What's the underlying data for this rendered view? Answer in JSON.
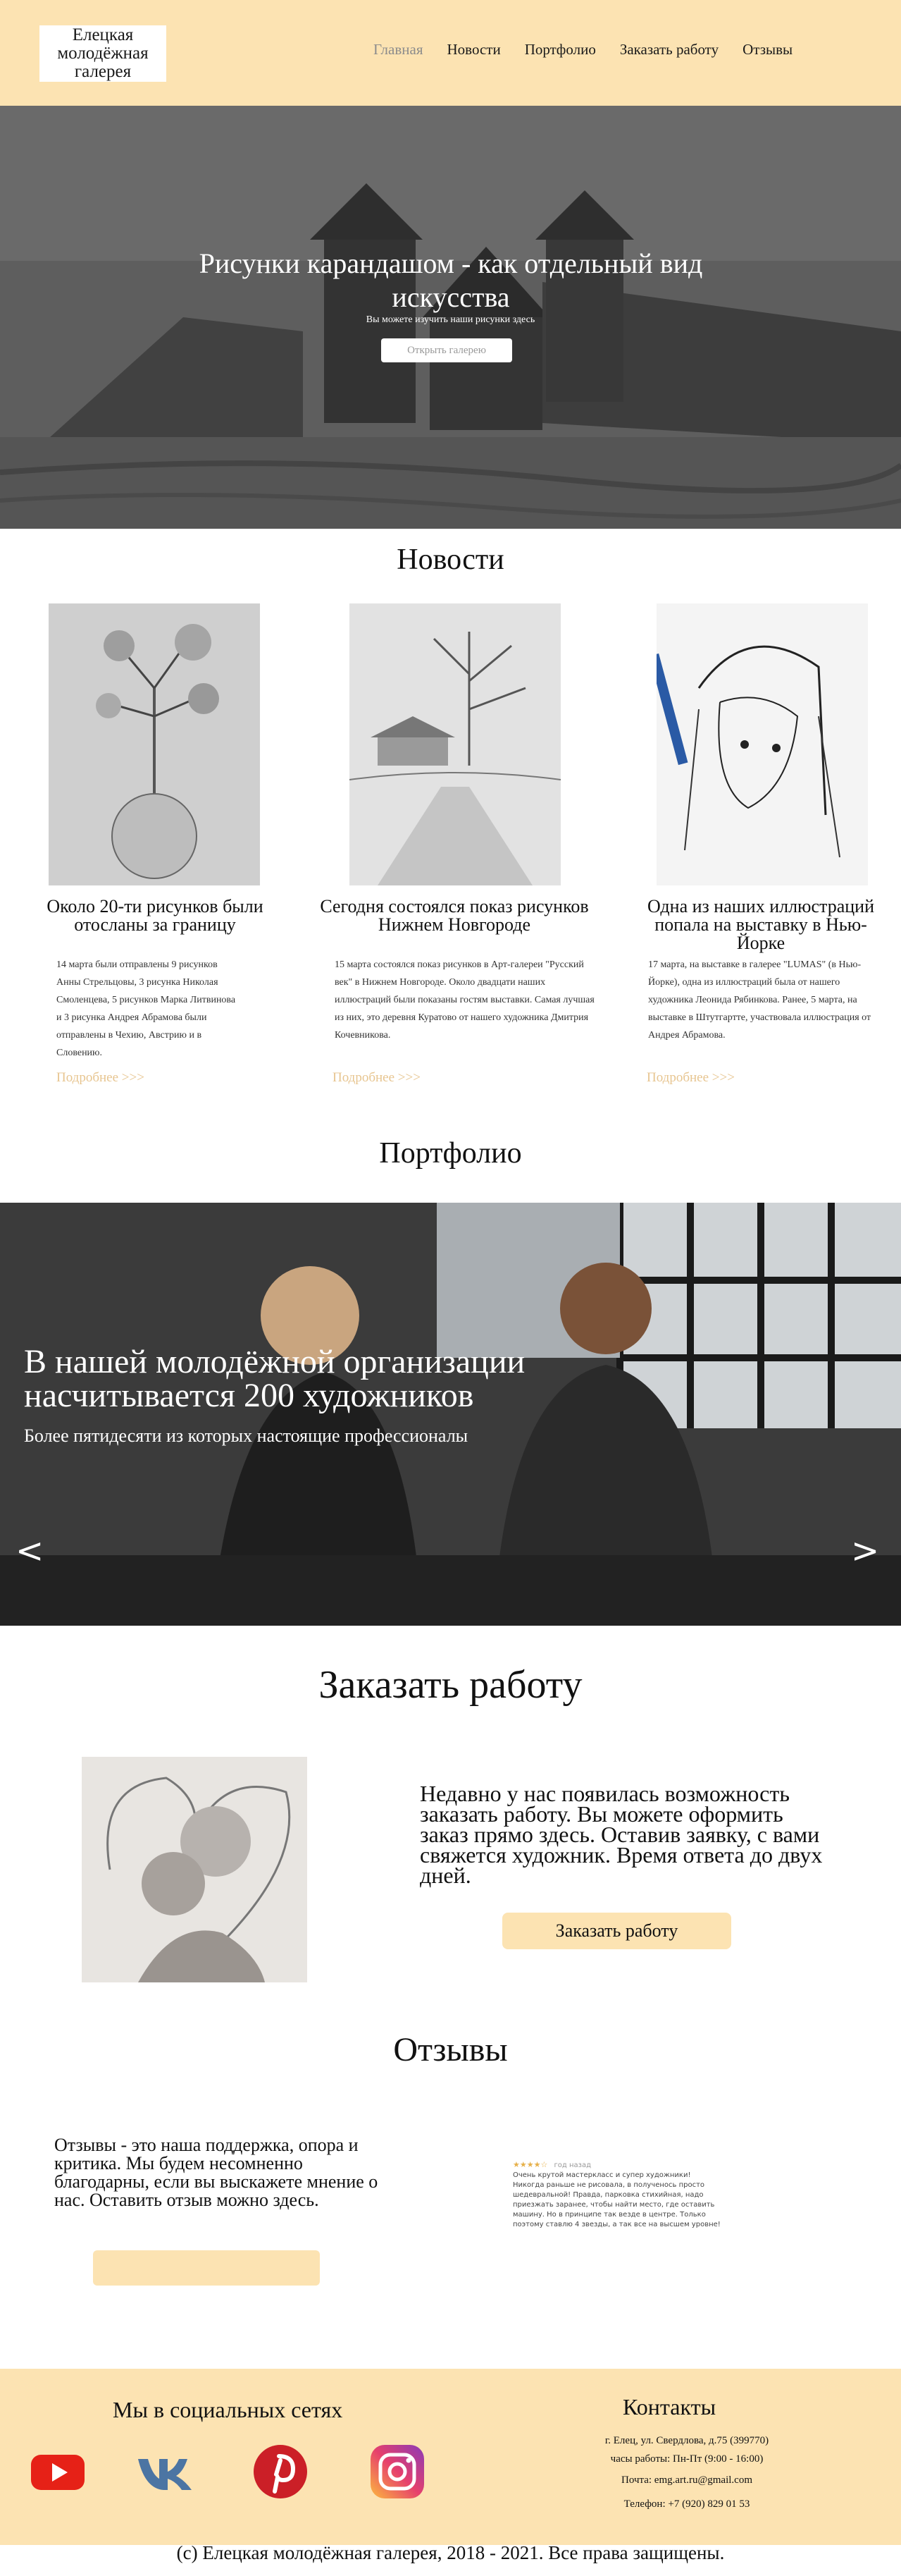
{
  "header": {
    "logo": "Елецкая молодёжная галерея",
    "nav": [
      {
        "label": "Главная",
        "active": true
      },
      {
        "label": "Новости",
        "active": false
      },
      {
        "label": "Портфолио",
        "active": false
      },
      {
        "label": "Заказать работу",
        "active": false
      },
      {
        "label": "Отзывы",
        "active": false
      }
    ]
  },
  "hero": {
    "title": "Рисунки карандашом - как отдельный вид искусства",
    "subtitle": "Вы можете изучить наши рисунки здесь",
    "button": "Открыть галерею"
  },
  "news": {
    "heading": "Новости",
    "items": [
      {
        "title": "Около 20-ти рисунков были отосланы за границу",
        "text": "14 марта были отправлены 9 рисунков Анны Стрельцовы, 3 рисунка Николая Смоленцева, 5 рисунков Марка Литвинова и 3 рисунка Андрея Абрамова были отправлены в Чехию, Австрию и в Словению.",
        "more": "Подробнее >>>"
      },
      {
        "title": "Сегодня состоялся показ рисунков Нижнем Новгороде",
        "text": "15 марта состоялся показ рисунков в Арт-галереи \"Русский век\" в Нижнем Новгороде. Около двадцати наших иллюстраций были показаны гостям выставки. Самая лучшая из них, это деревня Куратово от нашего художника Дмитрия Кочевникова.",
        "more": "Подробнее >>>"
      },
      {
        "title": "Одна из наших иллюстраций попала на выставку в Нью-Йорке",
        "text": "17 марта, на выставке в галерее \"LUMAS\" (в Нью-Йорке), одна из иллюстраций была от нашего художника Леонида Рябинкова. Ранее, 5 марта, на выставке в Штутгартте, участвовала иллюстрация от Андрея Абрамова.",
        "more": "Подробнее >>>"
      }
    ]
  },
  "portfolio": {
    "heading": "Портфолио",
    "slide_title": "В нашей молодёжной организации насчитывается 200 художников",
    "slide_subtitle": "Более пятидесяти из которых настоящие профессионалы",
    "prev": "<",
    "next": ">"
  },
  "order": {
    "heading": "Заказать работу",
    "text": "Недавно у нас появилась возможность заказать работу. Вы можете оформить заказ прямо здесь. Оставив заявку, с вами свяжется художник. Время ответа до двух дней.",
    "button": "Заказать работу"
  },
  "reviews": {
    "heading": "Отзывы",
    "text": "Отзывы - это наша поддержка, опора и критика. Мы будем несомненно благодарны, если вы выскажете мнение о нас. Оставить отзыв можно здесь.",
    "card": {
      "stars": "★★★★☆",
      "date": "год назад",
      "body": "Очень крутой мастеркласс и супер художники! Никогда раньше не рисовала, в полученось просто шедевральной! Правда, парковка стихийная, надо приезжать заранее, чтобы найти место, где оставить машину. Но в принципе так везде в центре. Только поэтому ставлю 4 звезды, а так все на высшем уровне!"
    }
  },
  "footer": {
    "social_title": "Мы в социальных сетях",
    "social": [
      "youtube-icon",
      "vk-icon",
      "pinterest-icon",
      "instagram-icon"
    ],
    "contacts_title": "Контакты",
    "address": "г. Елец, ул. Свердлова, д.75 (399770)",
    "hours": "часы работы: Пн-Пт (9:00 - 16:00)",
    "email": "Почта: emg.art.ru@gmail.com",
    "phone": "Телефон: +7 (920) 829 01 53"
  },
  "copyright": "(c) Елецкая молодёжная галерея, 2018 - 2021. Все права защищены.",
  "colors": {
    "accent": "#fce3b2",
    "link_more": "#e7c590"
  }
}
